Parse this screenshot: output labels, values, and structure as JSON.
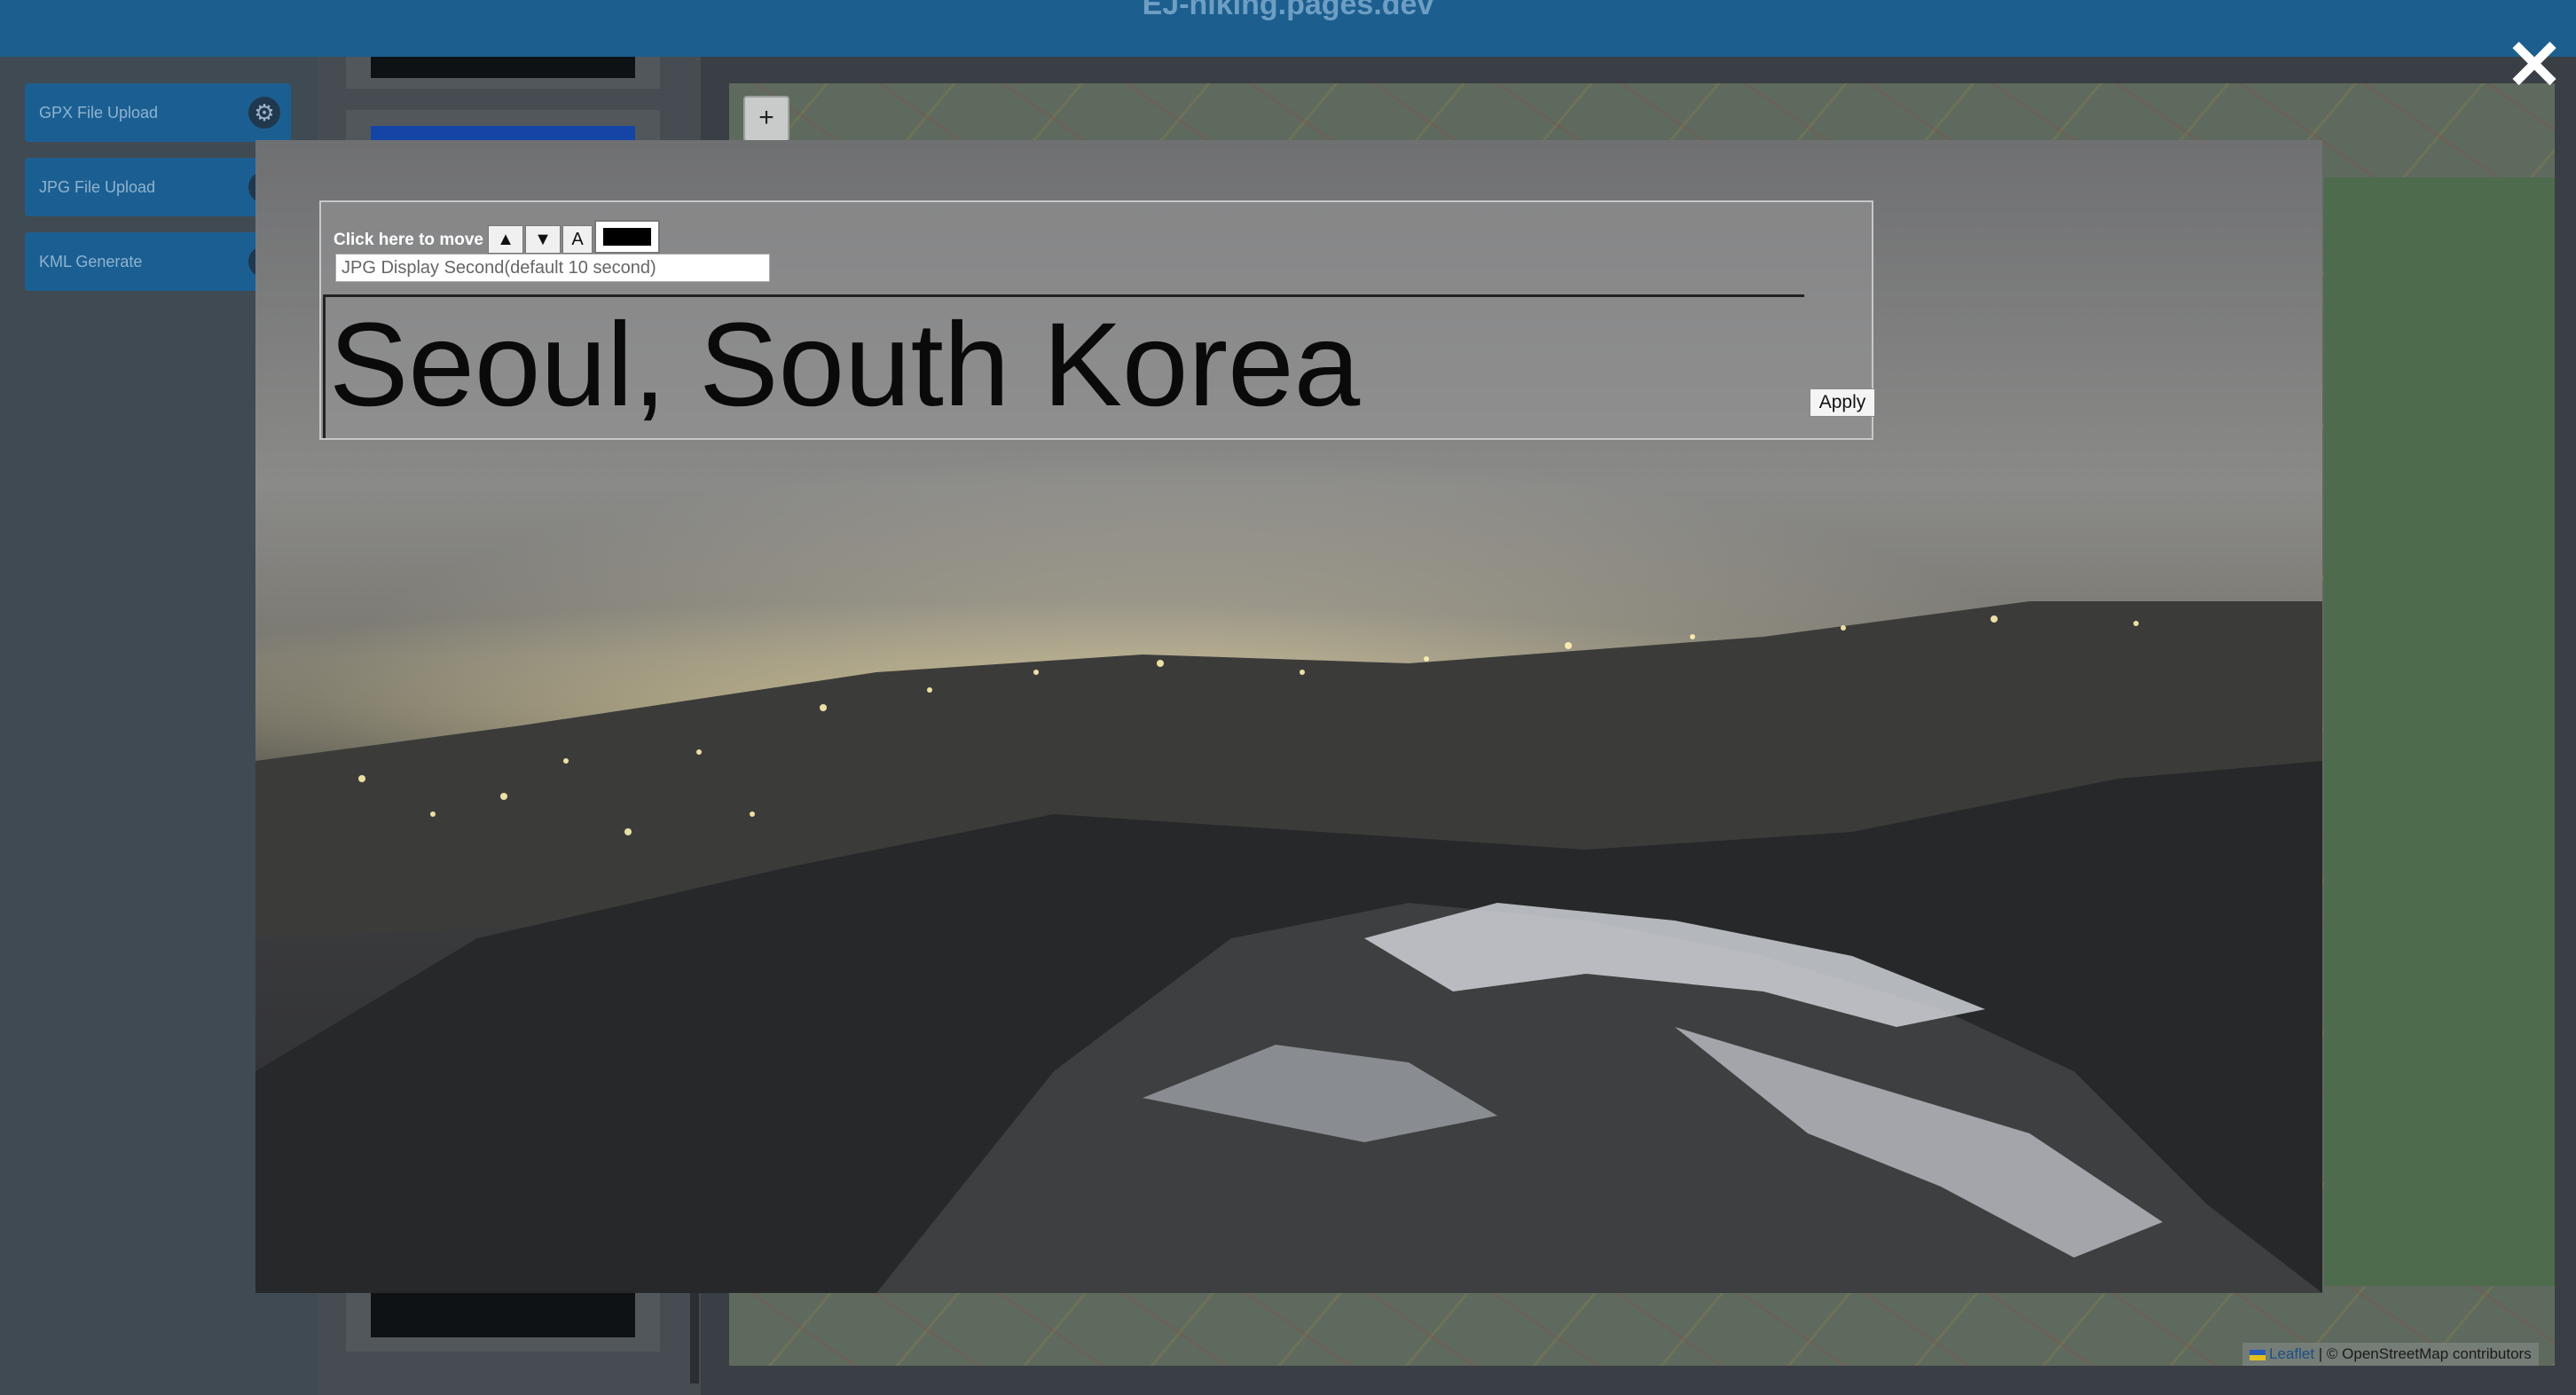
{
  "header": {
    "site_title": "EJ-hiking.pages.dev"
  },
  "sidebar": {
    "buttons": [
      {
        "label": "GPX File Upload",
        "icon": "gear-icon"
      },
      {
        "label": "JPG File Upload",
        "icon": "gear-icon"
      },
      {
        "label": "KML Generate",
        "icon": "gear-icon"
      }
    ]
  },
  "map": {
    "zoom_in_label": "+",
    "attribution": {
      "leaflet": "Leaflet",
      "separator": " | © OpenStreetMap contributors"
    }
  },
  "modal": {
    "close_label": "✕",
    "editor": {
      "move_label": "Click here to move",
      "up_label": "▲",
      "down_label": "▼",
      "font_label": "A",
      "text_color": "#000000",
      "seconds_placeholder": "JPG Display Second(default 10 second)",
      "seconds_value": "",
      "caption": "Seoul, South Korea",
      "apply_label": "Apply"
    }
  },
  "colors": {
    "header_bg": "#1c5f8e",
    "button_bg": "#1b5f92"
  }
}
